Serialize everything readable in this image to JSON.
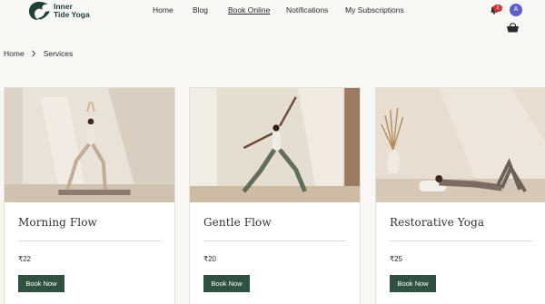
{
  "header": {
    "brand": {
      "line1": "Inner",
      "line2": "Tide Yoga"
    },
    "nav": [
      {
        "label": "Home"
      },
      {
        "label": "Blog"
      },
      {
        "label": "Book Online"
      },
      {
        "label": "Notifications"
      },
      {
        "label": "My Subscriptions"
      }
    ],
    "notification_count": "2",
    "avatar_initial": "A"
  },
  "breadcrumb": {
    "home": "Home",
    "current": "Services"
  },
  "services": [
    {
      "title": "Morning Flow",
      "price": "₹22",
      "button": "Book Now"
    },
    {
      "title": "Gentle Flow",
      "price": "₹20",
      "button": "Book Now"
    },
    {
      "title": "Restorative Yoga",
      "price": "₹25",
      "button": "Book Now"
    }
  ],
  "colors": {
    "brand": "#1e4038",
    "button": "#2f5140",
    "badge": "#d23434",
    "avatar": "#5b5fc7"
  },
  "icons": [
    "wave-logo-icon",
    "bell-icon",
    "cart-icon",
    "chevron-right-icon"
  ]
}
